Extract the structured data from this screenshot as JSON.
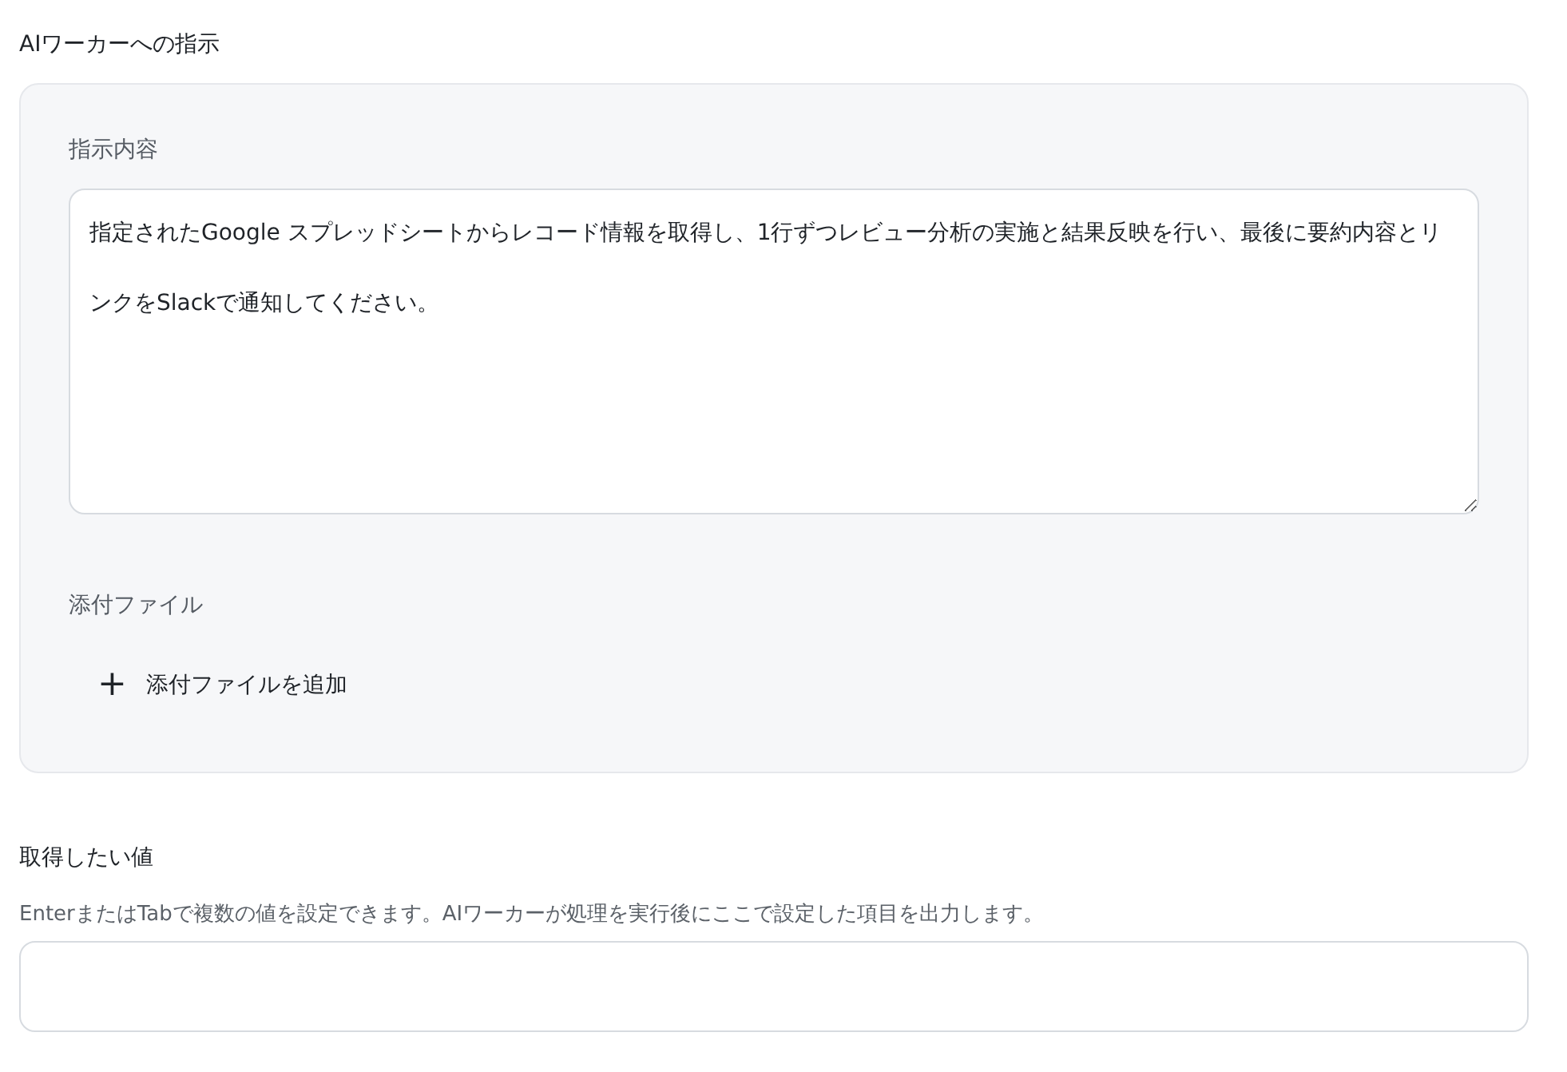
{
  "instruction_section": {
    "title": "AIワーカーへの指示",
    "content_label": "指示内容",
    "content_value": "指定されたGoogle スプレッドシートからレコード情報を取得し、1行ずつレビュー分析の実施と結果反映を行い、最後に要約内容とリンクをSlackで通知してください。",
    "attachments_label": "添付ファイル",
    "add_attachment_icon": "+",
    "add_attachment_button": "添付ファイルを追加"
  },
  "output_section": {
    "title": "取得したい値",
    "help_text": "EnterまたはTabで複数の値を設定できます。AIワーカーが処理を実行後にここで設定した項目を出力します。"
  }
}
